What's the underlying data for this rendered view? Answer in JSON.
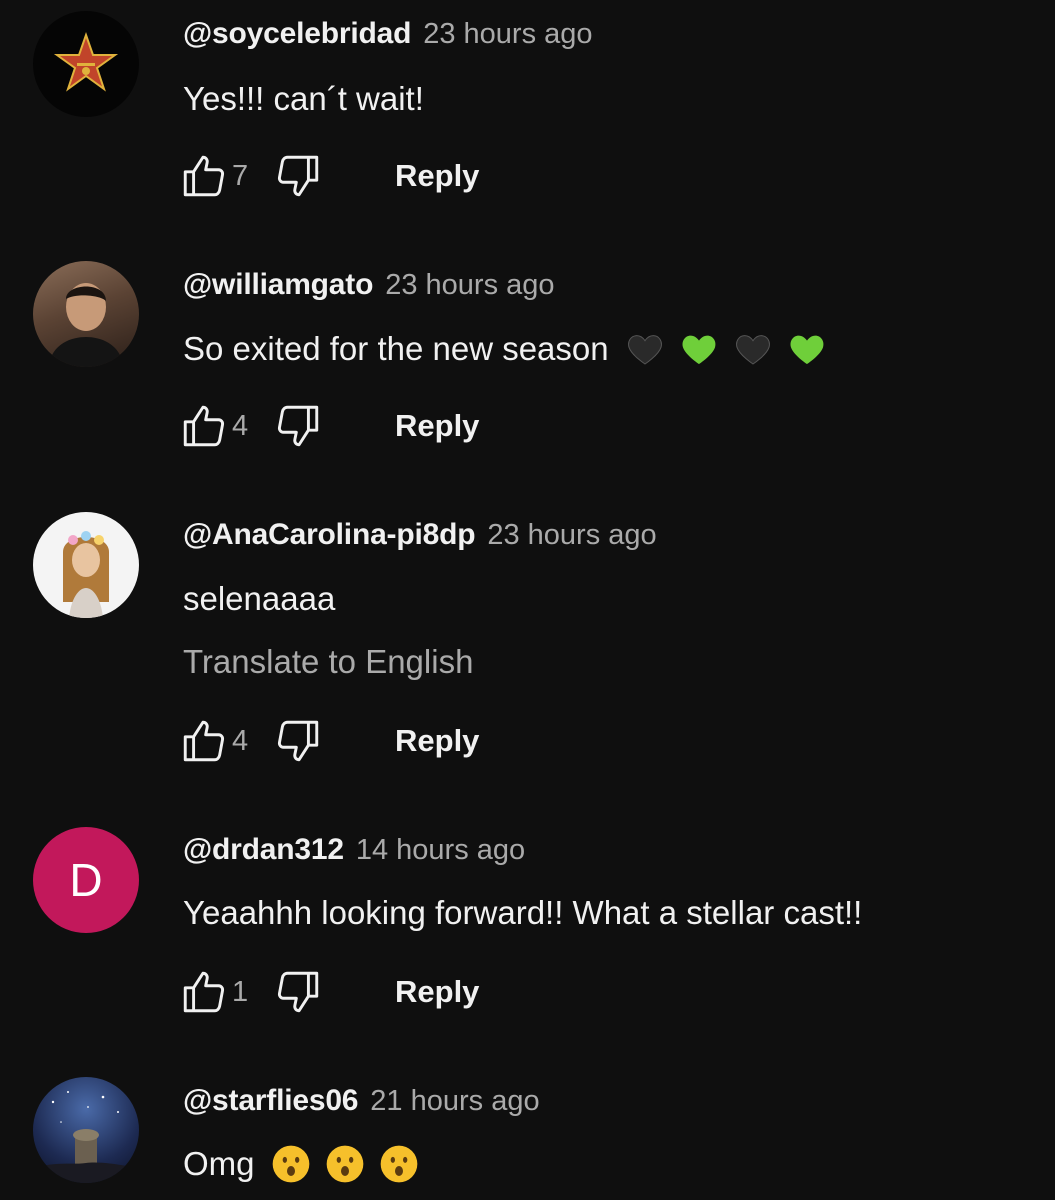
{
  "labels": {
    "reply": "Reply",
    "translate": "Translate to English"
  },
  "comments": [
    {
      "author": "@soycelebridad",
      "time": "23 hours ago",
      "text": "Yes!!! can´t wait!",
      "likes": "7",
      "avatar": "star-badge-avatar"
    },
    {
      "author": "@williamgato",
      "time": "23 hours ago",
      "text": "So exited for the new season",
      "likes": "4",
      "emojis": [
        "black-heart-emoji",
        "green-heart-emoji",
        "black-heart-emoji",
        "green-heart-emoji"
      ],
      "avatar": "photo-avatar"
    },
    {
      "author": "@AnaCarolina-pi8dp",
      "time": "23 hours ago",
      "text": "selenaaaa",
      "likes": "4",
      "avatar": "photo-avatar"
    },
    {
      "author": "@drdan312",
      "time": "14 hours ago",
      "text": "Yeaahhh looking forward!! What a stellar cast!!",
      "likes": "1",
      "avatar_letter": "D",
      "avatar_color": "#c2185b"
    },
    {
      "author": "@starflies06",
      "time": "21 hours ago",
      "text": "Omg",
      "emojis": [
        "astonished-face-emoji",
        "astonished-face-emoji",
        "astonished-face-emoji"
      ],
      "avatar": "photo-avatar"
    }
  ],
  "colors": {
    "background": "#0f0f0f",
    "primary_text": "#f1f1f1",
    "secondary_text": "#aaaaaa",
    "green_heart": "#6fcf3a"
  }
}
